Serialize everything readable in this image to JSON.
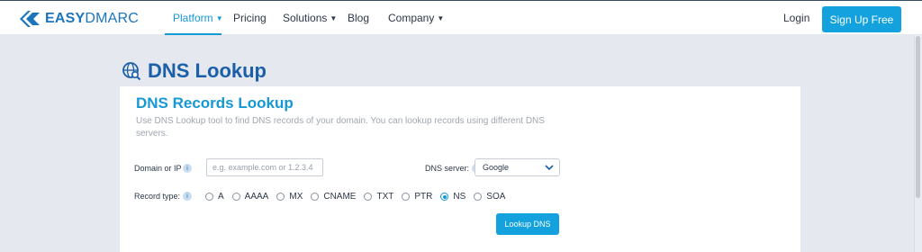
{
  "brand": {
    "name_bold": "EASY",
    "name_rest": "DMARC"
  },
  "nav": {
    "items": [
      {
        "label": "Platform",
        "has_dropdown": true,
        "active": true
      },
      {
        "label": "Pricing",
        "has_dropdown": false,
        "active": false
      },
      {
        "label": "Solutions",
        "has_dropdown": true,
        "active": false
      },
      {
        "label": "Blog",
        "has_dropdown": false,
        "active": false
      },
      {
        "label": "Company",
        "has_dropdown": true,
        "active": false
      }
    ],
    "login_label": "Login",
    "signup_label": "Sign Up Free"
  },
  "page": {
    "title": "DNS Lookup"
  },
  "card": {
    "title": "DNS Records Lookup",
    "description": "Use DNS Lookup tool to find DNS records of your domain. You can lookup records using different DNS servers."
  },
  "form": {
    "domain_label": "Domain or IP",
    "domain_placeholder": "e.g. example.com or 1.2.3.4",
    "domain_value": "",
    "dns_server_label": "DNS server:",
    "dns_server_value": "Google",
    "record_type_label": "Record type:",
    "record_types": [
      "A",
      "AAAA",
      "MX",
      "CNAME",
      "TXT",
      "PTR",
      "NS",
      "SOA"
    ],
    "selected_record_type": "NS",
    "submit_label": "Lookup DNS"
  },
  "colors": {
    "accent": "#13a2dd",
    "title_blue": "#1b5fa8",
    "card_title": "#1698d6",
    "background": "#e5e8ef"
  }
}
